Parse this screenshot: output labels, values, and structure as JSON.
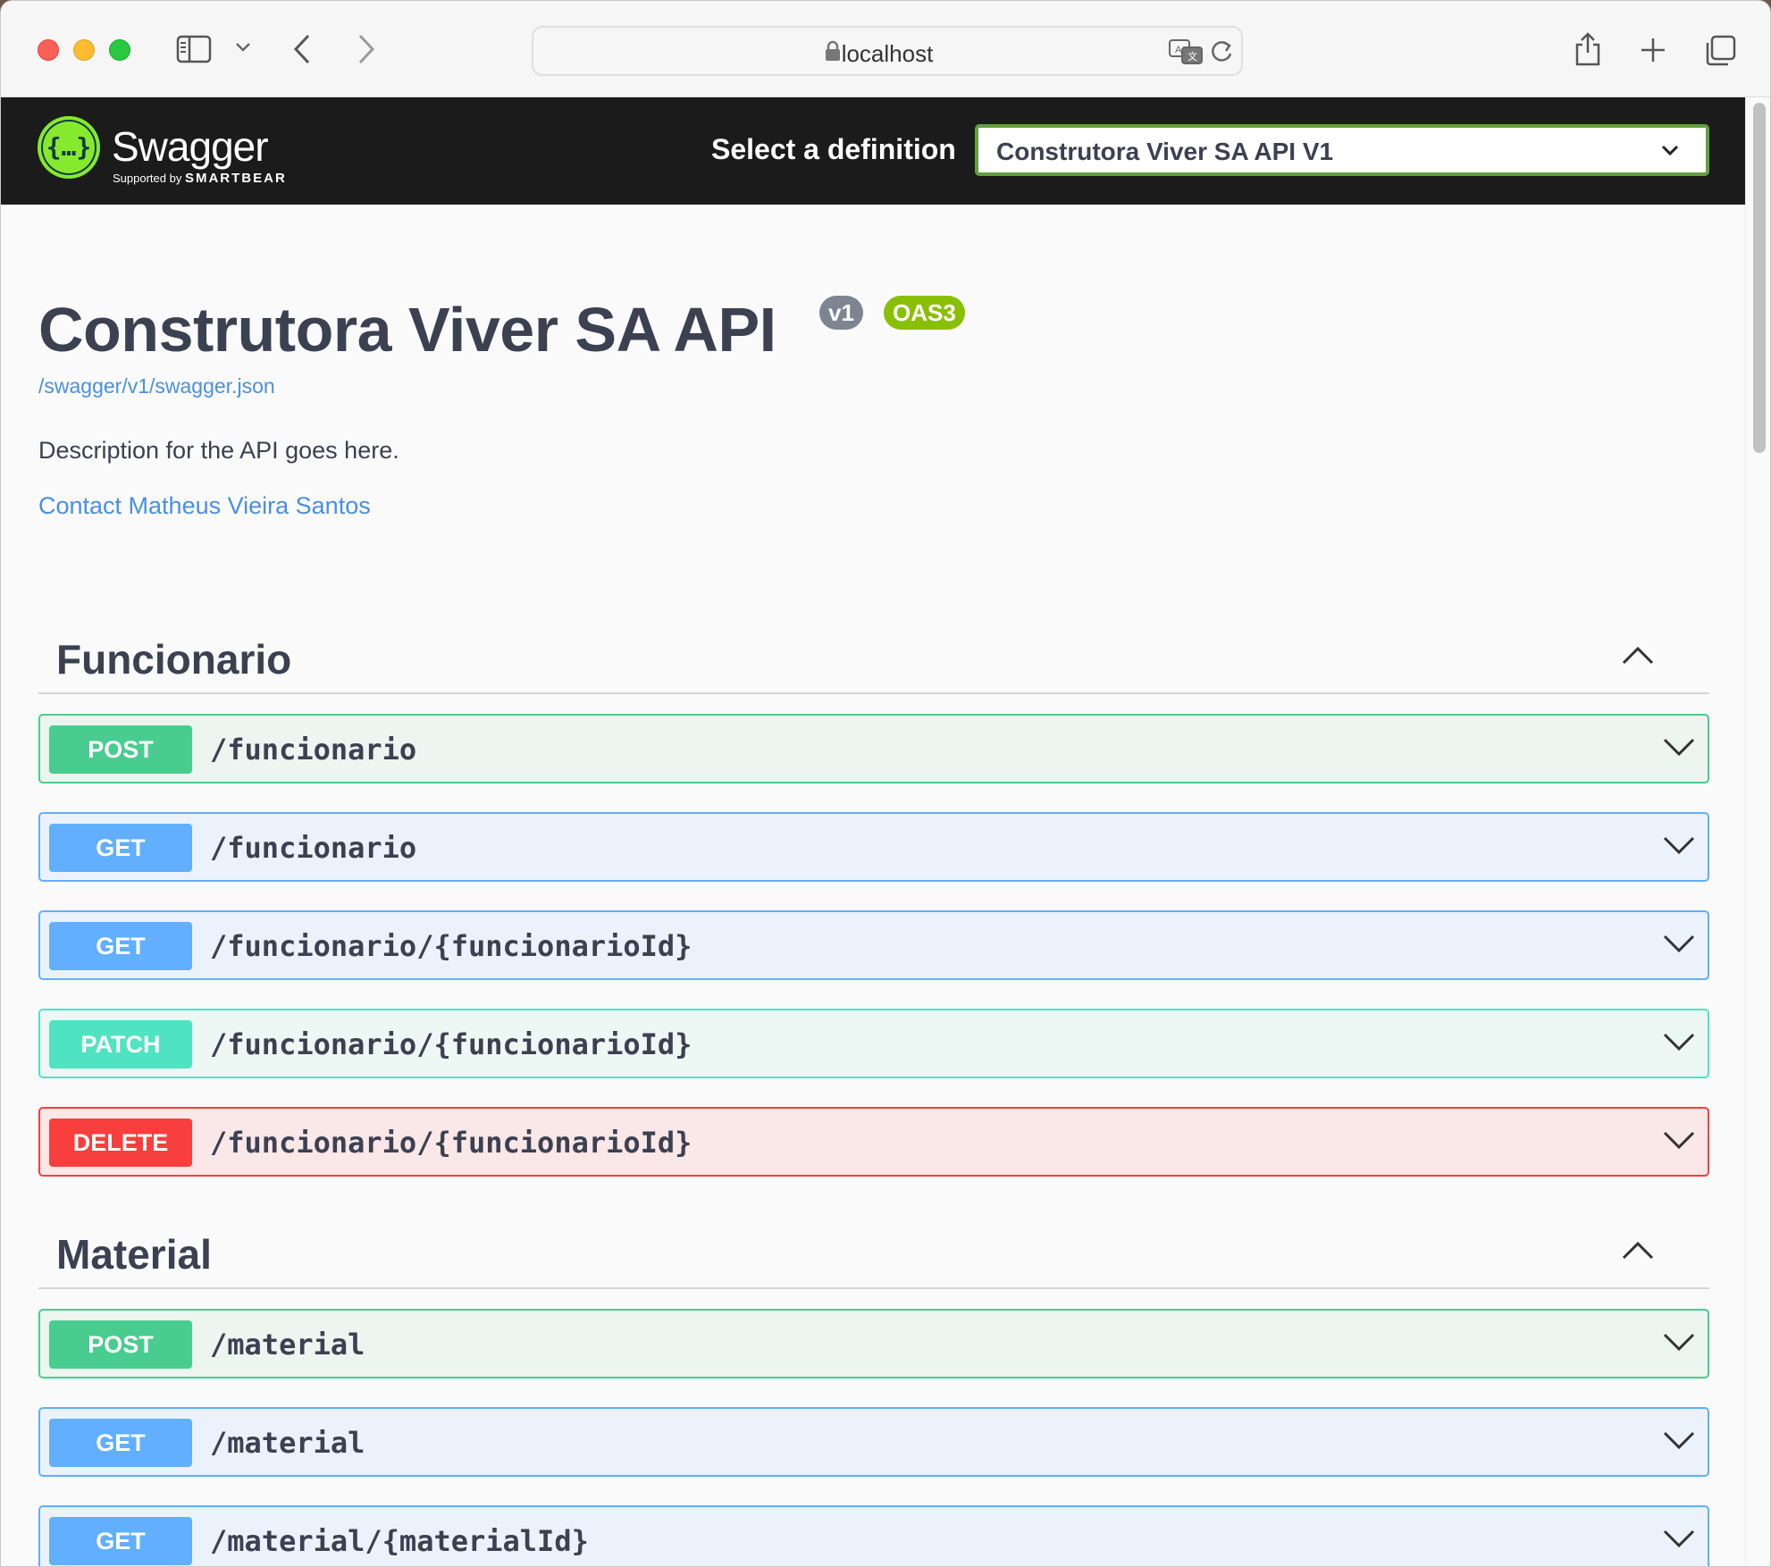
{
  "browser": {
    "url": "localhost",
    "icons": [
      "sidebar-icon",
      "chevron-down-icon",
      "back-icon",
      "forward-icon",
      "lock-icon",
      "translate-icon",
      "reload-icon",
      "share-icon",
      "new-tab-icon",
      "tabs-overview-icon"
    ]
  },
  "topbar": {
    "logo_word": "Swagger",
    "logo_sub_prefix": "Supported by",
    "logo_sub_brand": "SMARTBEAR",
    "definition_label": "Select a definition",
    "definition_selected": "Construtora Viver SA API V1",
    "accent_color": "#62a03f"
  },
  "info": {
    "title": "Construtora Viver SA API",
    "version_badge": "v1",
    "oas_badge": "OAS3",
    "spec_link": "/swagger/v1/swagger.json",
    "description": "Description for the API goes here.",
    "contact": "Contact Matheus Vieira Santos"
  },
  "tags": [
    {
      "name": "Funcionario",
      "operations": [
        {
          "method": "POST",
          "path": "/funcionario"
        },
        {
          "method": "GET",
          "path": "/funcionario"
        },
        {
          "method": "GET",
          "path": "/funcionario/{funcionarioId}"
        },
        {
          "method": "PATCH",
          "path": "/funcionario/{funcionarioId}"
        },
        {
          "method": "DELETE",
          "path": "/funcionario/{funcionarioId}"
        }
      ]
    },
    {
      "name": "Material",
      "operations": [
        {
          "method": "POST",
          "path": "/material"
        },
        {
          "method": "GET",
          "path": "/material"
        },
        {
          "method": "GET",
          "path": "/material/{materialId}"
        }
      ]
    }
  ],
  "method_colors": {
    "POST": "#49cc90",
    "GET": "#61affe",
    "PATCH": "#50e3c2",
    "DELETE": "#f93e3e"
  }
}
